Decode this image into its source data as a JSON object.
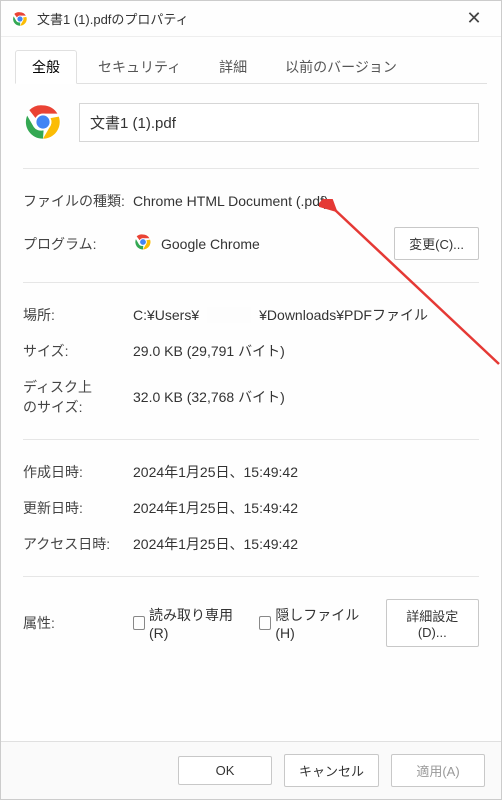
{
  "titlebar": {
    "title": "文書1 (1).pdfのプロパティ"
  },
  "tabs": {
    "general": "全般",
    "security": "セキュリティ",
    "details": "詳細",
    "previous": "以前のバージョン"
  },
  "filename": "文書1 (1).pdf",
  "labels": {
    "filetype": "ファイルの種類:",
    "program": "プログラム:",
    "location": "場所:",
    "size": "サイズ:",
    "disksize": "ディスク上\nのサイズ:",
    "created": "作成日時:",
    "modified": "更新日時:",
    "accessed": "アクセス日時:",
    "attributes": "属性:"
  },
  "values": {
    "filetype": "Chrome HTML Document (.pdf)",
    "program": "Google Chrome",
    "location_prefix": "C:¥Users¥",
    "location_suffix": "¥Downloads¥PDFファイル",
    "size": "29.0 KB (29,791 バイト)",
    "disksize": "32.0 KB (32,768 バイト)",
    "created": "2024年1月25日、15:49:42",
    "modified": "2024年1月25日、15:49:42",
    "accessed": "2024年1月25日、15:49:42"
  },
  "buttons": {
    "change": "変更(C)...",
    "advanced": "詳細設定(D)...",
    "ok": "OK",
    "cancel": "キャンセル",
    "apply": "適用(A)"
  },
  "checkboxes": {
    "readonly": "読み取り専用(R)",
    "hidden": "隠しファイル(H)"
  }
}
